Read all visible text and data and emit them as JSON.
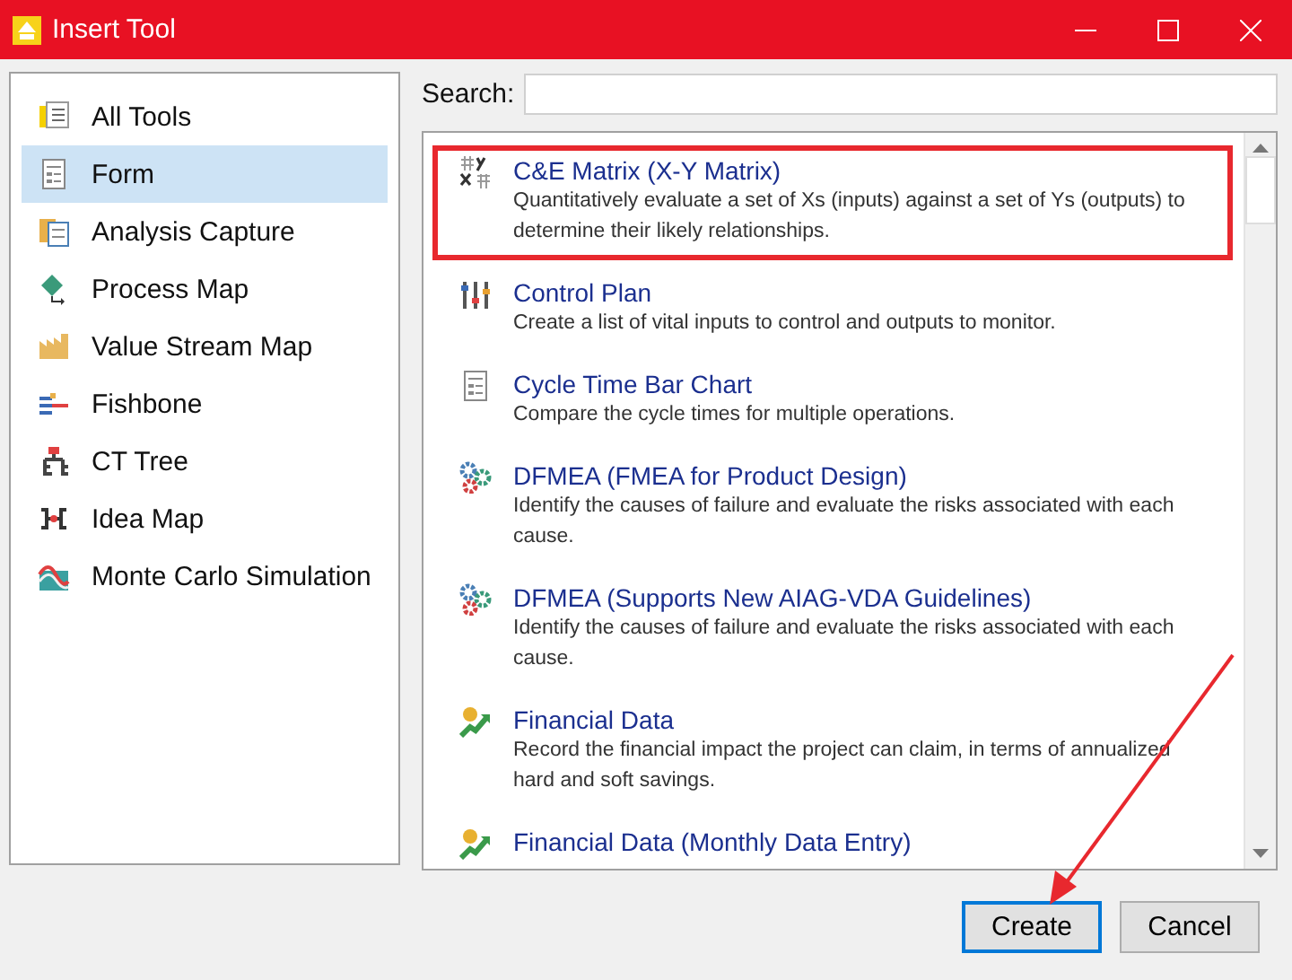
{
  "window": {
    "title": "Insert Tool"
  },
  "sidebar": {
    "items": [
      {
        "label": "All Tools",
        "kind": "all",
        "selected": false
      },
      {
        "label": "Form",
        "kind": "form",
        "selected": true
      },
      {
        "label": "Analysis Capture",
        "kind": "capture",
        "selected": false
      },
      {
        "label": "Process Map",
        "kind": "process",
        "selected": false
      },
      {
        "label": "Value Stream Map",
        "kind": "factory",
        "selected": false
      },
      {
        "label": "Fishbone",
        "kind": "fishbone",
        "selected": false
      },
      {
        "label": "CT Tree",
        "kind": "tree",
        "selected": false
      },
      {
        "label": "Idea Map",
        "kind": "idea",
        "selected": false
      },
      {
        "label": "Monte Carlo Simulation",
        "kind": "montecarlo",
        "selected": false
      }
    ]
  },
  "search": {
    "label": "Search:"
  },
  "tools": [
    {
      "title": "C&E Matrix (X-Y Matrix)",
      "description": "Quantitatively evaluate a set of Xs (inputs) against a set of Ys (outputs) to determine their likely relationships.",
      "kind": "matrix",
      "highlighted": true
    },
    {
      "title": "Control Plan",
      "description": "Create a list of vital inputs to control and outputs to monitor.",
      "kind": "sliders",
      "highlighted": false
    },
    {
      "title": "Cycle Time Bar Chart",
      "description": "Compare the cycle times for multiple operations.",
      "kind": "form",
      "highlighted": false
    },
    {
      "title": "DFMEA (FMEA for Product Design)",
      "description": "Identify the causes of failure and evaluate the risks associated with each cause.",
      "kind": "gears",
      "highlighted": false
    },
    {
      "title": "DFMEA (Supports New AIAG-VDA Guidelines)",
      "description": "Identify the causes of failure and evaluate the risks associated with each cause.",
      "kind": "gears",
      "highlighted": false
    },
    {
      "title": "Financial Data",
      "description": "Record the financial impact the project can claim, in terms of annualized hard and soft savings.",
      "kind": "money",
      "highlighted": false
    },
    {
      "title": "Financial Data (Monthly Data Entry)",
      "kind": "money",
      "highlighted": false
    }
  ],
  "buttons": [
    {
      "label": "Create",
      "default": true
    },
    {
      "label": "Cancel",
      "default": false
    }
  ],
  "annotation_arrow": true
}
